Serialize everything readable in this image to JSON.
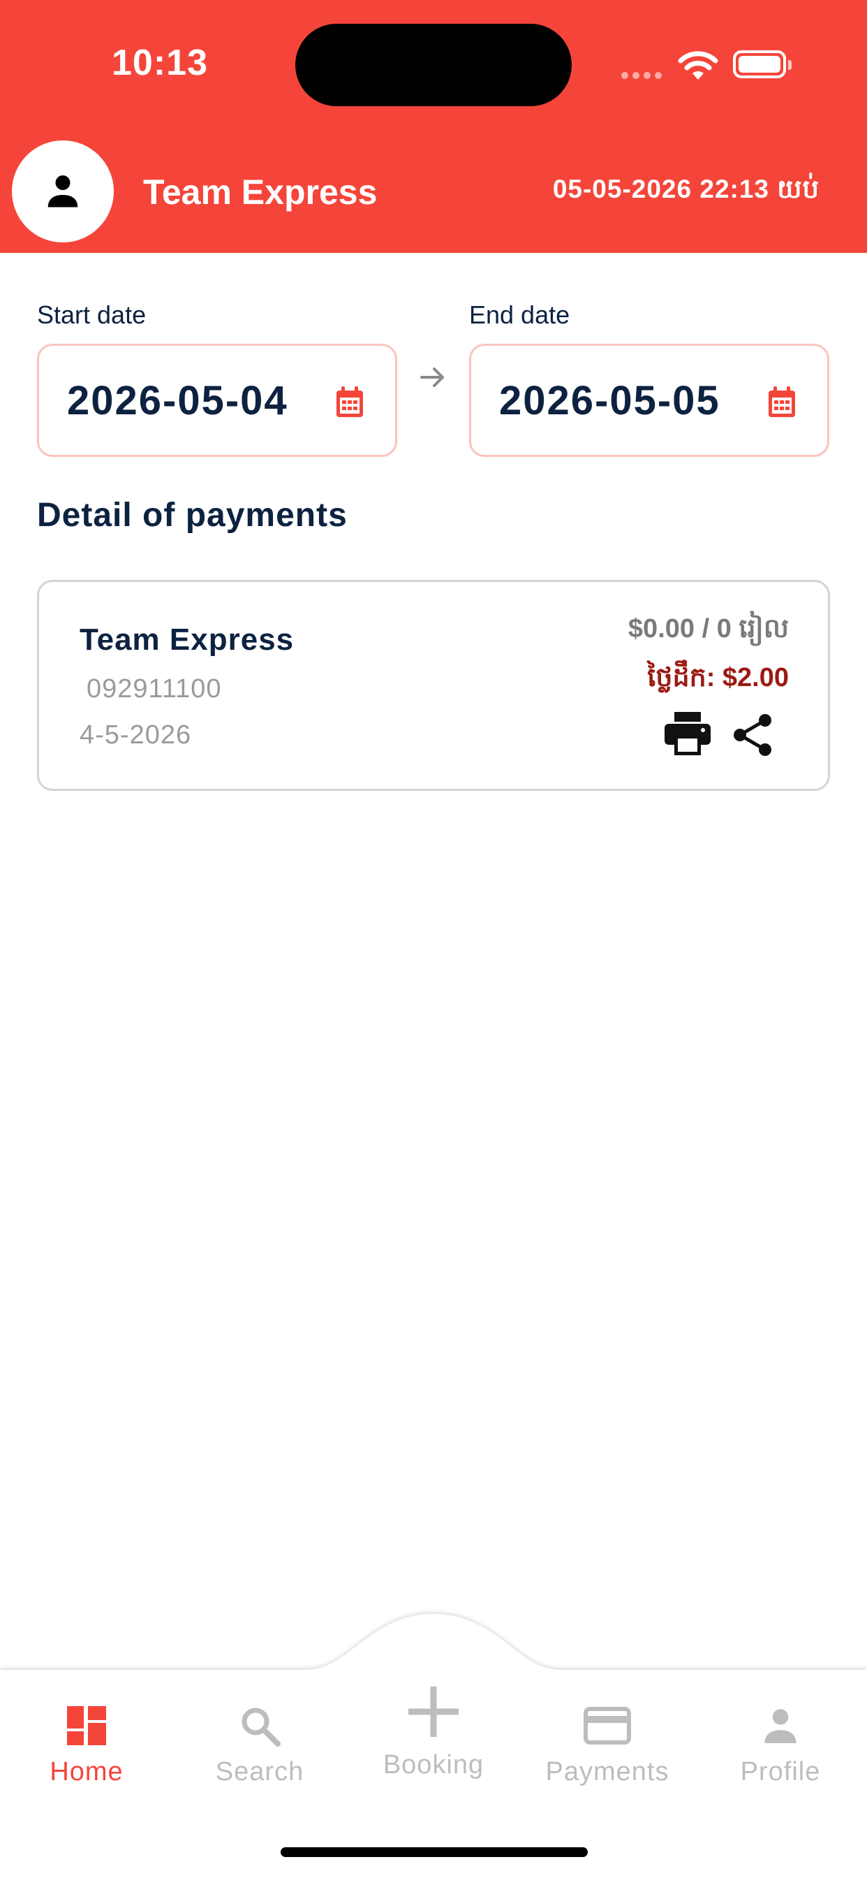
{
  "status_bar": {
    "time": "10:13"
  },
  "header": {
    "title": "Team Express",
    "datetime": "05-05-2026 22:13 យប់"
  },
  "filters": {
    "start_label": "Start date",
    "start_value": "2026-05-04",
    "end_label": "End date",
    "end_value": "2026-05-05"
  },
  "section_title": "Detail of payments",
  "payments": [
    {
      "name": "Team Express",
      "phone": "092911100",
      "date": "4-5-2026",
      "amount": "$0.00 / 0 រៀល",
      "fee": "ថ្លៃដឹក: $2.00"
    }
  ],
  "colors": {
    "brand": "#f5453a",
    "navy": "#0d2240",
    "fee": "#9b1a14"
  },
  "tabs": [
    {
      "label": "Home",
      "icon": "dashboard-icon",
      "active": true
    },
    {
      "label": "Search",
      "icon": "search-icon",
      "active": false
    },
    {
      "label": "Booking",
      "icon": "plus-icon",
      "active": false
    },
    {
      "label": "Payments",
      "icon": "credit-card-icon",
      "active": false
    },
    {
      "label": "Profile",
      "icon": "person-icon",
      "active": false
    }
  ]
}
